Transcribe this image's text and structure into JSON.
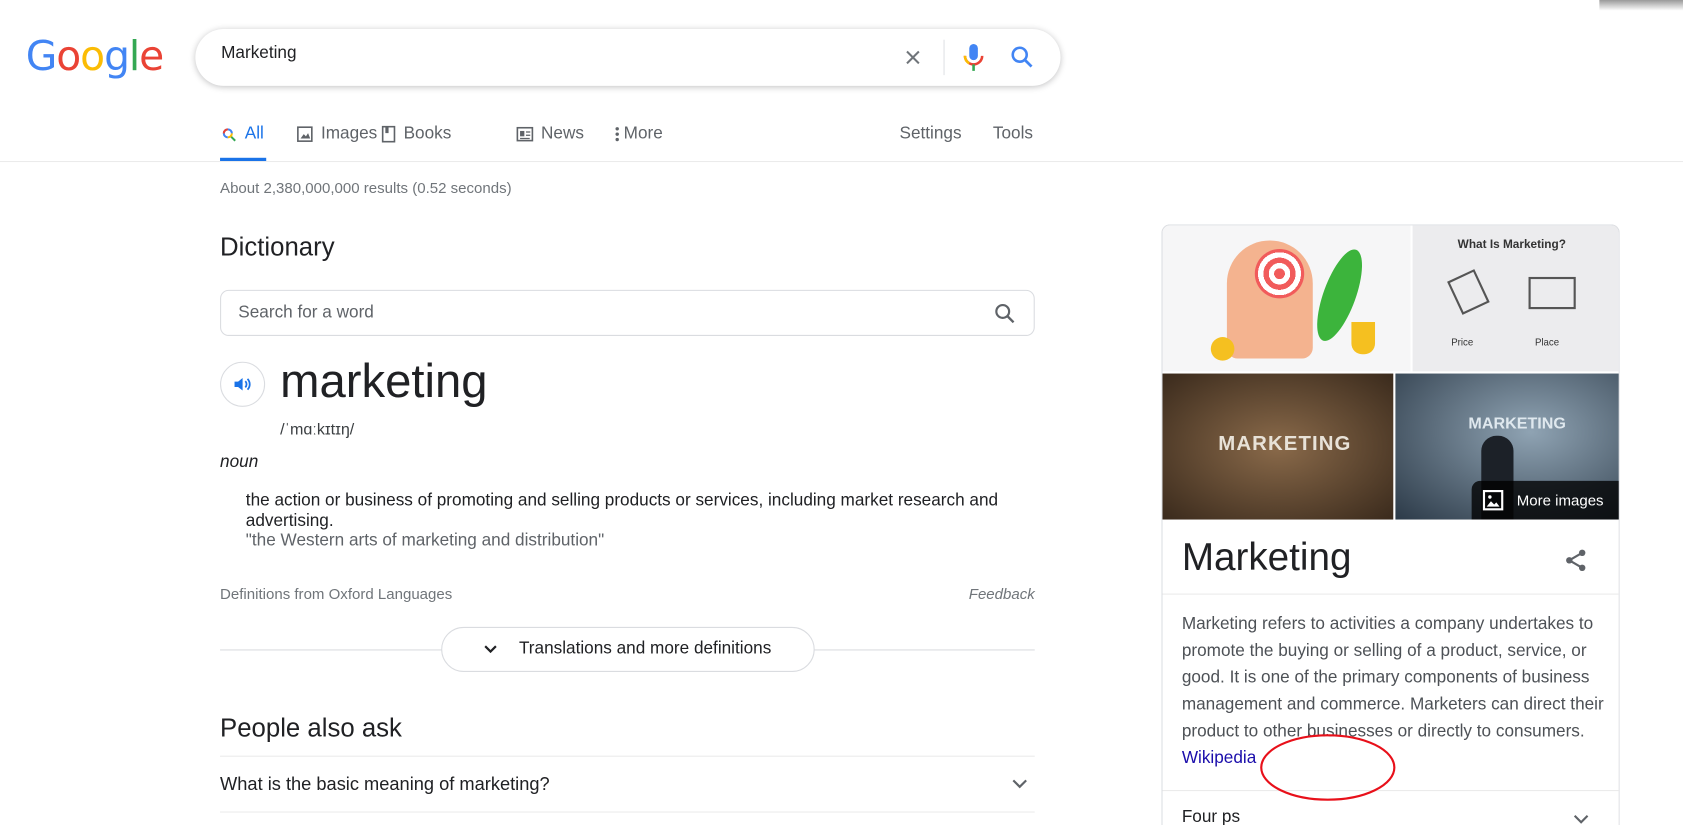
{
  "logo": "Google",
  "search": {
    "value": "Marketing"
  },
  "tabs": [
    {
      "label": "All",
      "icon": "search-icon"
    },
    {
      "label": "Images",
      "icon": "image-icon"
    },
    {
      "label": "Books",
      "icon": "book-icon"
    },
    {
      "label": "News",
      "icon": "news-icon"
    },
    {
      "label": "More",
      "icon": "more-vert-icon"
    }
  ],
  "tools": {
    "settings": "Settings",
    "tools": "Tools"
  },
  "stats": "About 2,380,000,000 results (0.52 seconds)",
  "dictionary": {
    "heading": "Dictionary",
    "search_placeholder": "Search for a word",
    "word": "marketing",
    "phonetic": "/ˈmɑːkɪtɪŋ/",
    "pos": "noun",
    "definition": "the action or business of promoting and selling products or services, including market research and advertising.",
    "example": "\"the Western arts of marketing and distribution\"",
    "source": "Definitions from Oxford Languages",
    "feedback": "Feedback",
    "more_button": "Translations and more definitions"
  },
  "paa": {
    "heading": "People also ask",
    "questions": [
      "What is the basic meaning of marketing?"
    ]
  },
  "knowledge_panel": {
    "images": {
      "img2_title": "What Is Marketing?",
      "img2_labels": [
        "Price",
        "Place"
      ],
      "img3_text": "MARKETING",
      "img4_text": "MARKETING",
      "more_images": "More images"
    },
    "title": "Marketing",
    "description": "Marketing refers to activities a company undertakes to promote the buying or selling of a product, service, or good. It is one of the primary components of business management and commerce. Marketers can direct their product to other businesses or directly to consumers.",
    "source_link": "Wikipedia",
    "section": "Four ps"
  },
  "colors": {
    "accent": "#1a73e8",
    "link": "#1a0dab",
    "annotation": "#e8101a"
  }
}
